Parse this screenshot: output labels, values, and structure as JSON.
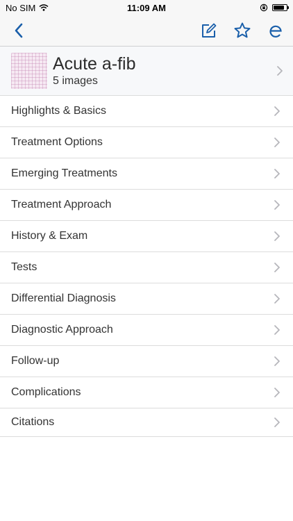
{
  "status": {
    "carrier": "No SIM",
    "time": "11:09 AM"
  },
  "nav": {
    "back_icon": "chevron-left-icon",
    "edit_icon": "edit-note-icon",
    "favorite_icon": "star-icon",
    "e_icon": "e-letter-icon",
    "accent_color": "#1a5faa"
  },
  "header": {
    "title": "Acute a-fib",
    "subtitle": "5 images"
  },
  "menu": {
    "items": [
      {
        "label": "Highlights & Basics"
      },
      {
        "label": "Treatment Options"
      },
      {
        "label": "Emerging Treatments"
      },
      {
        "label": "Treatment Approach"
      },
      {
        "label": "History & Exam"
      },
      {
        "label": "Tests"
      },
      {
        "label": "Differential Diagnosis"
      },
      {
        "label": "Diagnostic Approach"
      },
      {
        "label": "Follow-up"
      },
      {
        "label": "Complications"
      },
      {
        "label": "Citations"
      }
    ]
  }
}
